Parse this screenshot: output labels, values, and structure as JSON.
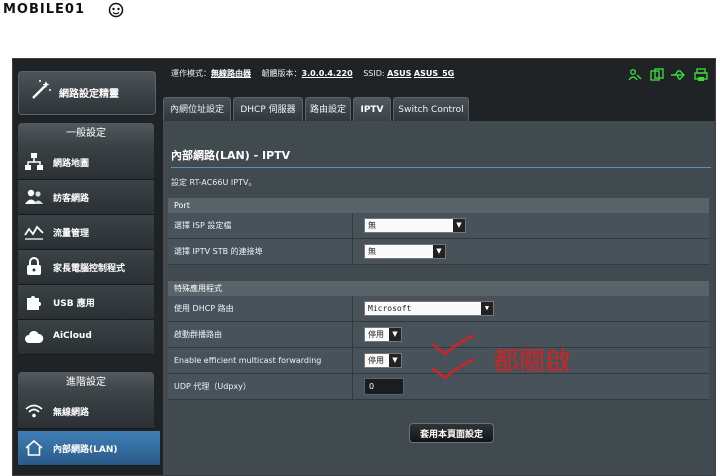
{
  "site_logo": {
    "text": "MOBILE01"
  },
  "sidebar": {
    "top_item": {
      "label": "網路設定精靈",
      "icon": "wand-icon"
    },
    "general_header": "一般設定",
    "general_items": [
      {
        "label": "網路地圖",
        "icon": "network-map-icon"
      },
      {
        "label": "訪客網路",
        "icon": "guest-network-icon"
      },
      {
        "label": "流量管理",
        "icon": "traffic-icon"
      },
      {
        "label": "家長電腦控制程式",
        "icon": "parental-control-icon"
      },
      {
        "label": "USB 應用",
        "icon": "puzzle-icon"
      },
      {
        "label": "AiCloud",
        "icon": "cloud-icon"
      }
    ],
    "advanced_header": "進階設定",
    "advanced_items": [
      {
        "label": "無線網路",
        "icon": "wifi-icon"
      },
      {
        "label": "內部網路(LAN)",
        "icon": "home-icon"
      }
    ]
  },
  "status_bar": {
    "mode_label": "運作模式：",
    "mode_value": "無線路由器",
    "firmware_label": "韌體版本：",
    "firmware_value": "3.0.0.4.220",
    "ssid_label": "SSID:",
    "ssid_1": "ASUS",
    "ssid_2": "ASUS_5G"
  },
  "tabs": [
    {
      "label": "內網位址設定"
    },
    {
      "label": "DHCP 伺服器"
    },
    {
      "label": "路由設定"
    },
    {
      "label": "IPTV"
    },
    {
      "label": "Switch Control"
    }
  ],
  "panel": {
    "title": "內部網路(LAN) - IPTV",
    "description": "設定 RT-AC66U IPTV。",
    "port_group": {
      "header": "Port",
      "rows": [
        {
          "label": "選擇 ISP 設定檔",
          "value": "無"
        },
        {
          "label": "選擇 IPTV STB 的連接埠",
          "value": "無"
        }
      ]
    },
    "special_group": {
      "header": "特殊應用程式",
      "rows": [
        {
          "label": "使用 DHCP 路由",
          "value": "Microsoft"
        },
        {
          "label": "啟動群播路由",
          "value": "停用"
        },
        {
          "label": "Enable efficient multicast forwarding",
          "value": "停用"
        },
        {
          "label": "UDP 代理（Udpxy）",
          "value": "0"
        }
      ]
    },
    "apply_button": "套用本頁面設定"
  },
  "annotation": {
    "text": "都關啟"
  },
  "colors": {
    "accent": "#3f7fb6",
    "annotation": "#d22323",
    "status_icons": "#3fd43a"
  }
}
